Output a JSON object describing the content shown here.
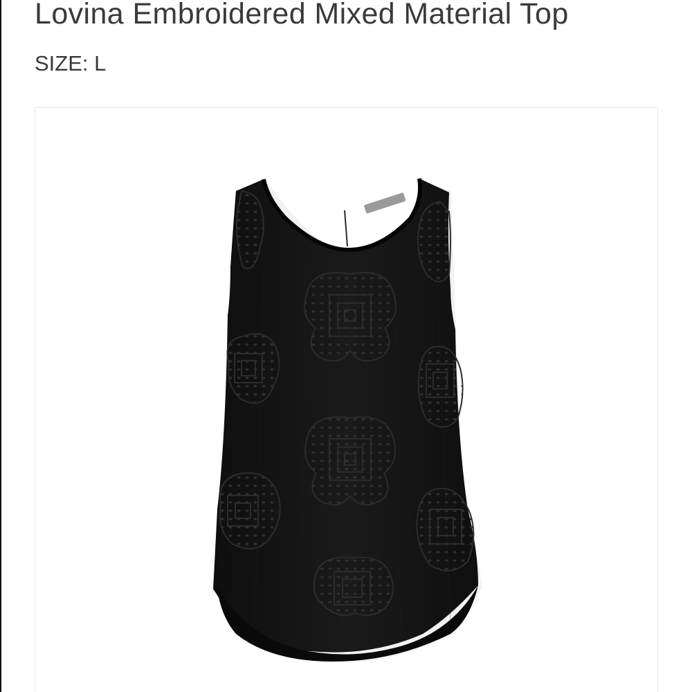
{
  "product": {
    "title": "Lovina Embroidered Mixed Material Top",
    "size_label": "SIZE:",
    "size_value": "L",
    "image_alt": "Black sleeveless embroidered top",
    "garment_color": "#141414",
    "label_tag_color": "#9a9a9a"
  }
}
